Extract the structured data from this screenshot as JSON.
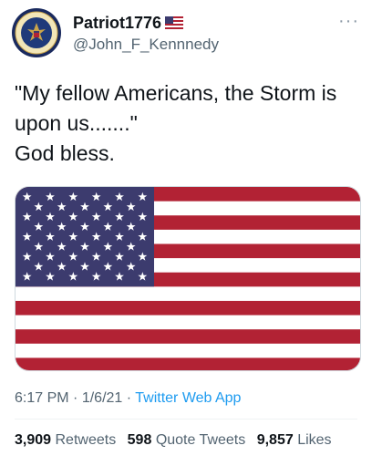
{
  "user": {
    "display_name": "Patriot1776",
    "flag_emoji": "🇺🇸",
    "handle": "@John_F_Kennnedy"
  },
  "tweet": {
    "text": "\"My fellow Americans, the Storm is upon us.......\"\nGod bless."
  },
  "meta": {
    "time": "6:17 PM",
    "separator": "·",
    "date": "1/6/21",
    "app": "Twitter Web App"
  },
  "stats": {
    "retweets_count": "3,909",
    "retweets_label": "Retweets",
    "quote_count": "598",
    "quote_label": "Quote Tweets",
    "likes_count": "9,857",
    "likes_label": "Likes"
  },
  "colors": {
    "flag_red": "#b22234",
    "flag_blue": "#3c3b6e",
    "link_blue": "#1d9bf0"
  },
  "icons": [
    "presidential-seal-icon",
    "us-flag-icon",
    "more-options-icon"
  ]
}
